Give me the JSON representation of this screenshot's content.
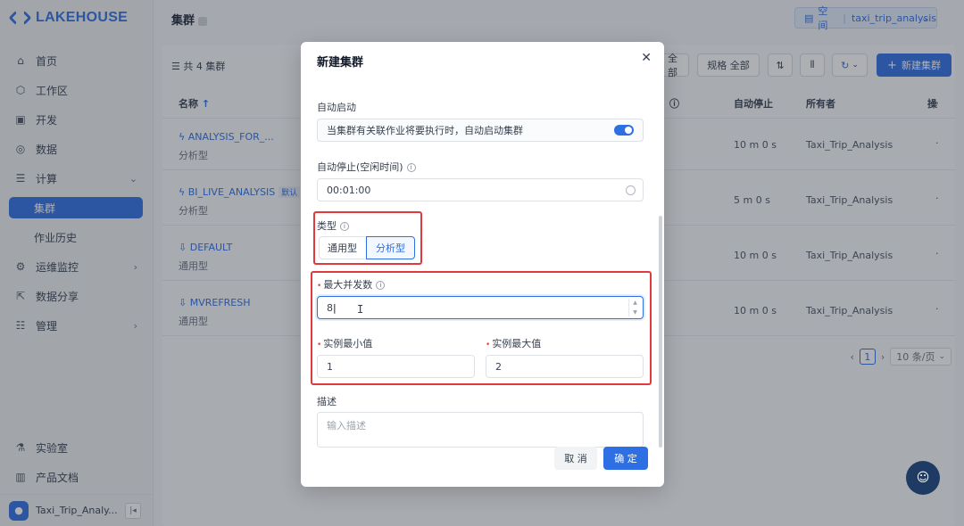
{
  "brand": {
    "name": "LAKEHOUSE"
  },
  "sidebar": {
    "items": [
      {
        "label": "首页",
        "icon": "home-icon"
      },
      {
        "label": "工作区",
        "icon": "cube-icon"
      },
      {
        "label": "开发",
        "icon": "terminal-icon"
      },
      {
        "label": "数据",
        "icon": "database-icon"
      },
      {
        "label": "计算",
        "icon": "compute-icon"
      },
      {
        "label": "集群",
        "icon": ""
      },
      {
        "label": "作业历史",
        "icon": ""
      },
      {
        "label": "运维监控",
        "icon": "monitor-icon"
      },
      {
        "label": "数据分享",
        "icon": "share-icon"
      },
      {
        "label": "管理",
        "icon": "manage-icon"
      }
    ],
    "bottom_items": [
      {
        "label": "实验室",
        "icon": "flask-icon"
      },
      {
        "label": "产品文档",
        "icon": "book-icon"
      }
    ],
    "user": "Taxi_Trip_Analy..."
  },
  "header": {
    "title": "集群",
    "workspace_label": "空间",
    "workspace_value": "taxi_trip_analysis"
  },
  "main": {
    "count": "共 4 集群",
    "filter_status": "全部",
    "filter_spec": "规格 全部",
    "new_button": "新建集群",
    "columns": {
      "name": "名称",
      "auto_stop": "自动停止",
      "owner": "所有者",
      "ops": "操作"
    },
    "rows": [
      {
        "name": "ANALYSIS_FOR_...",
        "type": "分析型",
        "auto_stop": "10 m 0 s",
        "owner": "Taxi_Trip_Analysis",
        "tag": ""
      },
      {
        "name": "BI_LIVE_ANALYSIS",
        "type": "分析型",
        "auto_stop": "5 m 0 s",
        "owner": "Taxi_Trip_Analysis",
        "tag": "默认"
      },
      {
        "name": "DEFAULT",
        "type": "通用型",
        "auto_stop": "10 m 0 s",
        "owner": "Taxi_Trip_Analysis",
        "tag": ""
      },
      {
        "name": "MVREFRESH",
        "type": "通用型",
        "auto_stop": "10 m 0 s",
        "owner": "Taxi_Trip_Analysis",
        "tag": ""
      }
    ],
    "pager": {
      "page": "1",
      "size": "10 条/页"
    }
  },
  "modal": {
    "title": "新建集群",
    "auto_start_label": "自动启动",
    "auto_start_text": "当集群有关联作业将要执行时，自动启动集群",
    "auto_start_on": true,
    "auto_stop_label": "自动停止(空闲时间)",
    "auto_stop_value": "00:01:00",
    "type_label": "类型",
    "type_options": [
      "通用型",
      "分析型"
    ],
    "type_selected": "分析型",
    "max_concurrency_label": "最大并发数",
    "max_concurrency_value": "8",
    "min_instance_label": "实例最小值",
    "min_instance_value": "1",
    "max_instance_label": "实例最大值",
    "max_instance_value": "2",
    "desc_label": "描述",
    "desc_placeholder": "输入描述",
    "cancel": "取 消",
    "ok": "确 定"
  },
  "colors": {
    "accent": "#2f6fe4",
    "highlight": "#e0393e"
  }
}
